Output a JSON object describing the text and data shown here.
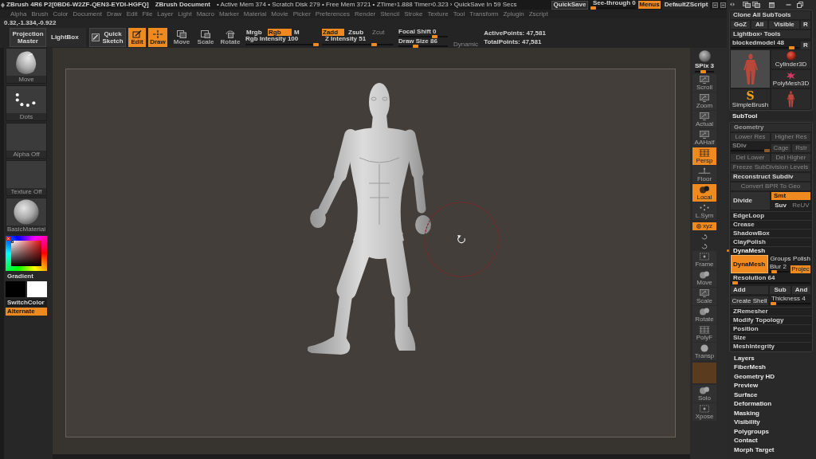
{
  "title_bar": {
    "app_title": "ZBrush 4R6 P2[0BD6-W2ZF-QEN3-EYDI-HGFQ]",
    "document": "ZBrush Document",
    "status": "• Active Mem 374 • Scratch Disk 279 • Free Mem 3721 • ZTime›1.888 Timer›0.323 › QuickSave In 59 Secs",
    "quicksave": "QuickSave",
    "see_through": {
      "label": "See-through 0",
      "level": 0
    },
    "menus": {
      "label": "Menus",
      "on": true
    },
    "script": "DefaultZScript"
  },
  "menu_bar": [
    "Alpha",
    "Brush",
    "Color",
    "Document",
    "Draw",
    "Edit",
    "File",
    "Layer",
    "Light",
    "Macro",
    "Marker",
    "Material",
    "Movie",
    "Picker",
    "Preferences",
    "Render",
    "Stencil",
    "Stroke",
    "Texture",
    "Tool",
    "Transform",
    "Zplugin",
    "Zscript"
  ],
  "toolbar": {
    "coordinates": "0.32,-1.334,-0.922",
    "projection_master": "Projection Master",
    "lightbox": "LightBox",
    "quick_sketch": "Quick Sketch",
    "edit": {
      "label": "Edit",
      "on": true
    },
    "modes": [
      {
        "label": "Draw",
        "selected": true
      },
      {
        "label": "Move",
        "selected": false
      },
      {
        "label": "Scale",
        "selected": false
      },
      {
        "label": "Rotate",
        "selected": false
      }
    ],
    "color_modes": [
      {
        "label": "Mrgb",
        "selected": false
      },
      {
        "label": "Rgb",
        "selected": true
      },
      {
        "label": "M",
        "selected": false
      }
    ],
    "rgb_intensity": {
      "label": "Rgb Intensity 100",
      "level": 1
    },
    "z_modes": [
      {
        "label": "Zadd",
        "selected": true,
        "disabled": false
      },
      {
        "label": "Zsub",
        "selected": false,
        "disabled": false
      },
      {
        "label": "Zcut",
        "selected": false,
        "disabled": true
      }
    ],
    "z_intensity": {
      "label": "Z Intensity 51",
      "level": 0.75
    },
    "focal_shift": {
      "label": "Focal Shift 0",
      "level": 0.77
    },
    "draw_size": {
      "label": "Draw Size 86",
      "level": 0.33
    },
    "dynamic": {
      "label": "Dynamic",
      "on": false
    },
    "active_points": "ActivePoints: 47,581",
    "total_points": "TotalPoints: 47,581"
  },
  "left_panel": {
    "thumbnails": [
      {
        "kind": "brush",
        "label": "Move"
      },
      {
        "kind": "stroke",
        "label": "Dots"
      },
      {
        "kind": "alpha",
        "label": "Alpha Off"
      },
      {
        "kind": "texture",
        "label": "Texture Off"
      },
      {
        "kind": "material",
        "label": "BasicMaterial"
      }
    ],
    "gradient": "Gradient",
    "swatches": [
      {
        "color": "#000000"
      },
      {
        "color": "#ffffff"
      }
    ],
    "switch_color": "SwitchColor",
    "alternate": {
      "label": "Alternate",
      "on": true
    }
  },
  "shelf": [
    {
      "kind": "spix",
      "label": "SPix 3",
      "level": 0.4
    },
    {
      "kind": "tool",
      "label": "Scroll",
      "on": false
    },
    {
      "kind": "tool",
      "label": "Zoom",
      "on": false
    },
    {
      "kind": "tool",
      "label": "Actual",
      "on": false
    },
    {
      "kind": "tool",
      "label": "AAHalf",
      "on": false
    },
    {
      "kind": "tool",
      "label": "Persp",
      "on": true
    },
    {
      "kind": "tool",
      "label": "Floor",
      "on": false
    },
    {
      "kind": "tool",
      "label": "Local",
      "on": true
    },
    {
      "kind": "tool",
      "label": "L.Sym",
      "on": false
    },
    {
      "kind": "axis",
      "label": "xyz",
      "on": true
    },
    {
      "kind": "axis",
      "on": false
    },
    {
      "kind": "axis",
      "on": false
    },
    {
      "kind": "tool",
      "label": "Frame",
      "on": false
    },
    {
      "kind": "tool",
      "label": "Move",
      "on": false
    },
    {
      "kind": "tool",
      "label": "Scale",
      "on": false
    },
    {
      "kind": "tool",
      "label": "Rotate",
      "on": false
    },
    {
      "kind": "tool",
      "label": "PolyF",
      "on": false
    },
    {
      "kind": "tool",
      "label": "Transp",
      "on": false
    },
    {
      "kind": "blank"
    },
    {
      "kind": "tool",
      "label": "Solo",
      "on": false
    },
    {
      "kind": "tool",
      "label": "Xpose",
      "on": false
    }
  ],
  "tray": {
    "tool_palette": {
      "clone_all": "Clone All SubTools",
      "goz_row": [
        {
          "label": "GoZ"
        },
        {
          "label": "All"
        },
        {
          "label": "Visible"
        },
        {
          "label": "R"
        }
      ],
      "lightbox_tools": "Lightbox› Tools",
      "current_tool": {
        "label": "blockedmodel 48",
        "level": 0.92
      },
      "reset": "R",
      "tools": [
        {
          "selected": true
        },
        {
          "label": "Cylinder3D",
          "selected": false
        },
        {
          "label": "PolyMesh3D",
          "selected": false
        },
        {
          "label": "SimpleBrush",
          "glyph": "S",
          "selected": false
        },
        {
          "selected": false
        }
      ]
    },
    "subtool": "SubTool",
    "geometry": {
      "title": "Geometry",
      "lower_res": {
        "label": "Lower Res",
        "disabled": true
      },
      "higher_res": {
        "label": "Higher Res",
        "disabled": true
      },
      "sdiv": {
        "label": "SDiv",
        "level": 1,
        "disabled": true
      },
      "cage": {
        "label": "Cage",
        "disabled": true
      },
      "rstr": {
        "label": "Rstr",
        "disabled": true
      },
      "del_lower": {
        "label": "Del Lower",
        "disabled": true
      },
      "del_higher": {
        "label": "Del Higher",
        "disabled": true
      },
      "freeze": {
        "label": "Freeze SubDivision Levels",
        "disabled": true
      },
      "reconstruct": {
        "label": "Reconstruct Subdiv",
        "disabled": false
      },
      "convert_bpr": {
        "label": "Convert BPR To Geo",
        "disabled": true
      },
      "divide": {
        "label": "Divide"
      },
      "smt": {
        "label": "Smt",
        "on": true
      },
      "suv": {
        "label": "Suv",
        "on": false
      },
      "reuv": {
        "label": "ReUV",
        "disabled": true
      },
      "subpalettes": [
        {
          "label": "EdgeLoop",
          "expanded": false
        },
        {
          "label": "Crease",
          "expanded": false
        },
        {
          "label": "ShadowBox",
          "expanded": false
        },
        {
          "label": "ClayPolish",
          "expanded": false
        },
        {
          "label": "DynaMesh",
          "expanded": true,
          "controls": {
            "dynamesh": {
              "label": "DynaMesh",
              "on": true
            },
            "groups": {
              "label": "Groups",
              "on": false
            },
            "polish": {
              "label": "Polish",
              "on": false
            },
            "blur": {
              "label": "Blur 2",
              "level": 0.1
            },
            "project": {
              "label": "Projec",
              "on": true
            },
            "resolution": {
              "label": "Resolution 64",
              "level": 0.02
            },
            "add": "Add",
            "sub": "Sub",
            "and": "And",
            "create_shell": "Create Shell",
            "thickness": {
              "label": "Thickness 4",
              "level": 0.02
            }
          }
        },
        {
          "label": "ZRemesher",
          "expanded": false
        },
        {
          "label": "Modify Topology",
          "expanded": false
        },
        {
          "label": "Position",
          "expanded": false
        },
        {
          "label": "Size",
          "expanded": false
        },
        {
          "label": "MeshIntegrity",
          "expanded": false
        }
      ]
    },
    "palettes": [
      "Layers",
      "FiberMesh",
      "Geometry HD",
      "Preview",
      "Surface",
      "Deformation",
      "Masking",
      "Visibility",
      "Polygroups",
      "Contact",
      "Morph Target"
    ]
  }
}
